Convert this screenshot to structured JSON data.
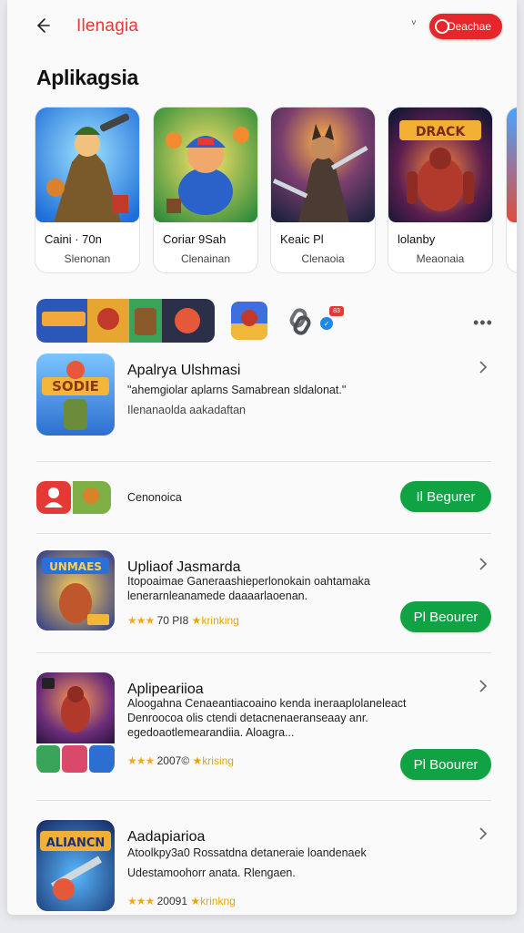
{
  "header": {
    "brand": "Ilenagia",
    "small_chevron": "˅",
    "pill_label": "Deachae"
  },
  "page_title": "Aplikagsia",
  "featured": [
    {
      "title": "Caini · 70n",
      "subtitle": "Slenonan",
      "colors": [
        "#1e6fd9",
        "#f29a2e"
      ],
      "icon": "warrior-art"
    },
    {
      "title": "Coriar 9Sah",
      "subtitle": "Clenainan",
      "colors": [
        "#f4c430",
        "#2a7be0"
      ],
      "icon": "hero-art"
    },
    {
      "title": "Keaic Pl",
      "subtitle": "Clenaoia",
      "colors": [
        "#3a2a5c",
        "#e27b2f"
      ],
      "icon": "fighter-art"
    },
    {
      "title": "lolanby",
      "subtitle": "Meaonaia",
      "colors": [
        "#16214a",
        "#d63c2f"
      ],
      "icon": "robot-art"
    }
  ],
  "strip_icons": [
    "game-strip",
    "game-mini",
    "chain-link-icon"
  ],
  "badge_count": "83",
  "apps": [
    {
      "title": "Apalrya Ulshmasi",
      "desc": [
        "\"ahemgiolar aplarns Samabrean sldalonat.\""
      ],
      "sub": "Ilenanaolda aakadaftan",
      "colors": [
        "#3f8be8",
        "#f1b03d"
      ]
    },
    {
      "title": "",
      "desc": [],
      "sub": "Cenonoica",
      "install": "Il Begurer",
      "colors": [
        "#e53935",
        "#6fae3a"
      ]
    },
    {
      "title": "Upliaof Jasmarda",
      "desc": [
        "Itopoaimae Ganeraashieperlonokain oahtamaka",
        "lenerarnleanamede daaaarlaoenan."
      ],
      "rating": "★★★",
      "meta": "70 PI8",
      "tag": "krinking",
      "install": "Pl Beourer",
      "colors": [
        "#2b3a8a",
        "#f0a32e"
      ]
    },
    {
      "title": "Aplipeariioa",
      "desc": [
        "Aloogahna Cenaeantiacoaino kenda ineraaplolaneleact",
        "Denroocoa olis ctendi detacnenaeranseaay anr.",
        "egedoaotlemearandiia. Aloagra..."
      ],
      "rating": "★★★",
      "meta": "2007©",
      "tag": "krising",
      "install": "Pl Boourer",
      "colors": [
        "#4a2466",
        "#e45c2a"
      ]
    },
    {
      "title": "Aadapiarioa",
      "desc": [
        "Atoolkpy3a0 Rossatdna detaneraie loandenaek",
        "Udestamoohorr anata. Rlengaen."
      ],
      "rating": "★★★",
      "meta": "20091",
      "tag": "krinkng",
      "colors": [
        "#12235c",
        "#e7a431"
      ]
    }
  ]
}
